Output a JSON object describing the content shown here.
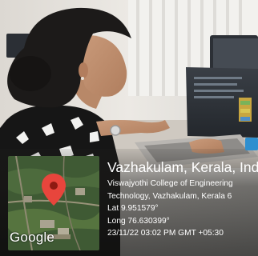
{
  "geotag": {
    "title": "Vazhakulam, Kerala, Ind",
    "address_line1": "Viswajyothi College of Engineering",
    "address_line2": "Technology, Vazhakulam, Kerala 6",
    "latitude": "Lat 9.951579°",
    "longitude": "Long 76.630399°",
    "timestamp": "23/11/22 03:02 PM GMT +05:30"
  },
  "map": {
    "logo_text": "Google",
    "pin_color": "#e8453c"
  }
}
